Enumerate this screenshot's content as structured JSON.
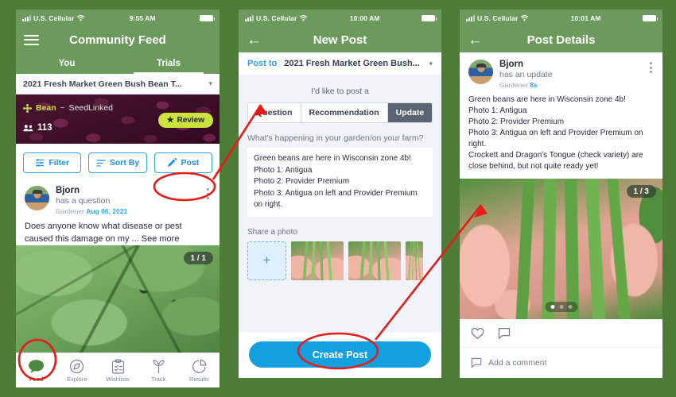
{
  "colors": {
    "page_bg": "#4d7c36",
    "app_green": "#6b9a5c",
    "accent_blue": "#13a0e0",
    "badge_lime": "#cbe33d",
    "segment_active": "#5a6472",
    "annotation_red": "#e81b1b"
  },
  "screen1": {
    "status": {
      "carrier": "U.S. Cellular",
      "time": "9:55 AM",
      "wifi_icon": "wifi-icon",
      "battery_icon": "battery-icon",
      "signal_icon": "signal-bars-icon"
    },
    "header": {
      "menu_icon": "hamburger-menu-icon",
      "title": "Community Feed"
    },
    "tabs": [
      {
        "label": "You",
        "active": false
      },
      {
        "label": "Trials",
        "active": true
      }
    ],
    "trial_selector": {
      "value": "2021 Fresh Market Green Bush Bean T...",
      "chevron_icon": "chevron-down-icon"
    },
    "banner": {
      "crop_icon": "sprout-icon",
      "crop": "Bean",
      "separator": "~",
      "org": "SeedLinked",
      "people_icon": "people-icon",
      "participants": "113",
      "review_label": "Review",
      "review_icon": "star-icon"
    },
    "actions": [
      {
        "label": "Filter",
        "icon": "filter-sliders-icon"
      },
      {
        "label": "Sort By",
        "icon": "sort-lines-icon"
      },
      {
        "label": "Post",
        "icon": "pencil-icon"
      }
    ],
    "post": {
      "avatar_icon": "user-avatar",
      "author": "Bjorn",
      "subtitle": "has a question",
      "role": "Gardener",
      "date": "Aug 06, 2021",
      "menu_icon": "kebab-menu-icon",
      "body": "Does anyone know what disease or pest caused this damage on my ... See more",
      "photo_counter": "1 / 1"
    },
    "bottom_nav": [
      {
        "label": "Feed",
        "icon": "chat-bubble-icon",
        "active": true
      },
      {
        "label": "Explore",
        "icon": "compass-icon",
        "active": false
      },
      {
        "label": "Wishlists",
        "icon": "clipboard-check-icon",
        "active": false
      },
      {
        "label": "Track",
        "icon": "sprout-icon",
        "active": false
      },
      {
        "label": "Results",
        "icon": "pie-chart-icon",
        "active": false
      }
    ]
  },
  "screen2": {
    "status": {
      "carrier": "U.S. Cellular",
      "time": "10:00 AM"
    },
    "header": {
      "back_icon": "back-arrow-icon",
      "title": "New Post"
    },
    "post_to": {
      "label": "Post to",
      "value": "2021 Fresh Market Green Bush...",
      "chevron_icon": "chevron-down-icon"
    },
    "type_prompt": "I'd like to post a",
    "type_options": [
      {
        "label": "Question",
        "active": false
      },
      {
        "label": "Recommendation",
        "active": false
      },
      {
        "label": "Update",
        "active": true
      }
    ],
    "composer": {
      "prompt": "What's happening in your garden/on your farm?",
      "value": "Green beans are here in Wisconsin zone 4b!\nPhoto 1: Antigua\nPhoto 2: Provider Premium\nPhoto 3: Antigua on left and Provider Premium on right."
    },
    "share_photo_label": "Share a photo",
    "add_photo_icon": "plus-icon",
    "thumbnails": [
      "green-beans-photo-1",
      "green-beans-photo-2",
      "green-beans-photo-3"
    ],
    "submit_label": "Create Post"
  },
  "screen3": {
    "status": {
      "carrier": "U.S. Cellular",
      "time": "10:01 AM"
    },
    "header": {
      "back_icon": "back-arrow-icon",
      "title": "Post Details"
    },
    "post": {
      "avatar_icon": "user-avatar",
      "author": "Bjorn",
      "subtitle": "has an update",
      "role": "Gardener",
      "date": "8s",
      "menu_icon": "kebab-menu-icon",
      "body": "Green beans are here in Wisconsin zone 4b!\nPhoto 1: Antigua\nPhoto 2: Provider Premium\nPhoto 3: Antigua on left and Provider Premium on right.\nCrockett and Dragon's Tongue (check variety) are close behind, but not quite ready yet!",
      "photo_counter": "1 / 3",
      "carousel_dots": 3,
      "carousel_active": 1
    },
    "reactions": [
      {
        "icon": "heart-outline-icon"
      },
      {
        "icon": "comment-outline-icon"
      }
    ],
    "comment_box": {
      "icon": "comment-outline-icon",
      "placeholder": "Add a comment"
    }
  },
  "annotations": [
    {
      "name": "ellipse-post-button",
      "shape": "ellipse"
    },
    {
      "name": "ellipse-feed-nav",
      "shape": "ellipse"
    },
    {
      "name": "ellipse-create-post-button",
      "shape": "ellipse"
    },
    {
      "name": "arrow-post-to-new-post",
      "shape": "arrow"
    },
    {
      "name": "arrow-create-post-to-details",
      "shape": "arrow"
    }
  ]
}
